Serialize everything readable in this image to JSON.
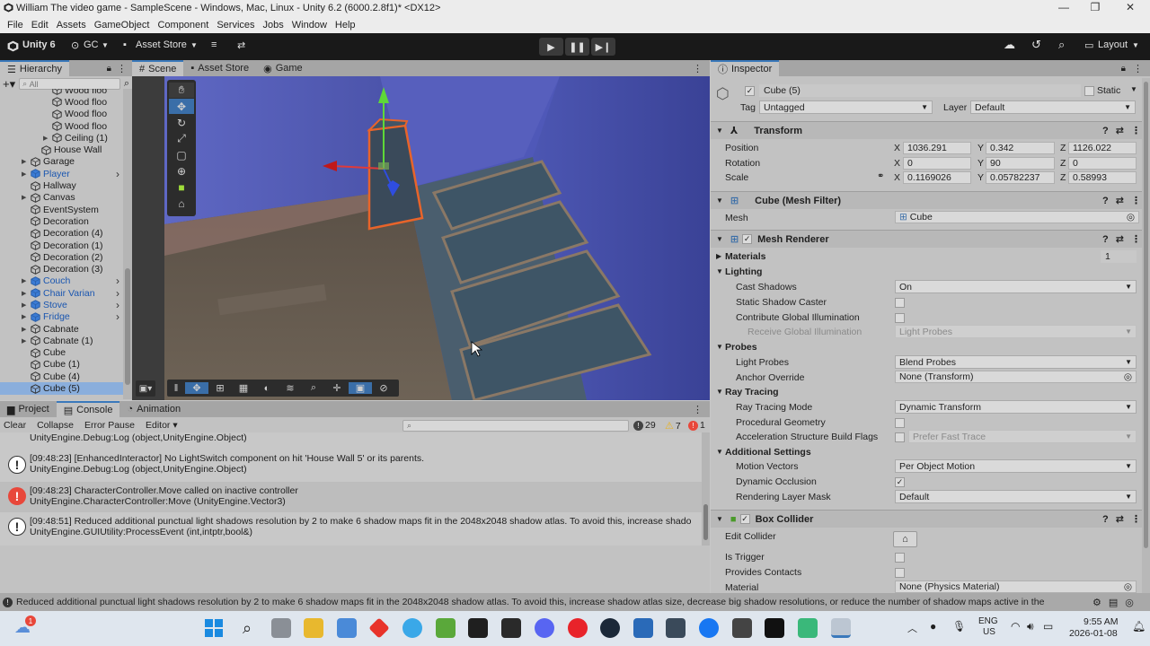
{
  "window": {
    "title": "William The video game - SampleScene - Windows, Mac, Linux - Unity 6.2 (6000.2.8f1)* <DX12>",
    "minimize": "—",
    "maximize": "❐",
    "close": "✕"
  },
  "menu": [
    "File",
    "Edit",
    "Assets",
    "GameObject",
    "Component",
    "Services",
    "Jobs",
    "Window",
    "Help"
  ],
  "toolbar": {
    "account": "Unity 6",
    "gc": "GC",
    "asset_store": "Asset Store",
    "layout": "Layout"
  },
  "hierarchy": {
    "tab": "Hierarchy",
    "search_placeholder": "All",
    "items": [
      {
        "label": "Wood floo",
        "indent": 5,
        "style": "normal",
        "arrow": false
      },
      {
        "label": "Wood floo",
        "indent": 5,
        "style": "normal",
        "arrow": false
      },
      {
        "label": "Wood floo",
        "indent": 5,
        "style": "normal",
        "arrow": false
      },
      {
        "label": "Wood floo",
        "indent": 5,
        "style": "normal",
        "arrow": false
      },
      {
        "label": "Ceiling (1)",
        "indent": 5,
        "style": "normal",
        "arrow": true
      },
      {
        "label": "House Wall",
        "indent": 4,
        "style": "normal",
        "arrow": false
      },
      {
        "label": "Garage",
        "indent": 3,
        "style": "normal",
        "arrow": true
      },
      {
        "label": "Player",
        "indent": 3,
        "style": "blue",
        "arrow": true
      },
      {
        "label": "Hallway",
        "indent": 3,
        "style": "normal",
        "arrow": false
      },
      {
        "label": "Canvas",
        "indent": 3,
        "style": "normal",
        "arrow": true
      },
      {
        "label": "EventSystem",
        "indent": 3,
        "style": "normal",
        "arrow": false
      },
      {
        "label": "Decoration",
        "indent": 3,
        "style": "normal",
        "arrow": false
      },
      {
        "label": "Decoration (4)",
        "indent": 3,
        "style": "normal",
        "arrow": false
      },
      {
        "label": "Decoration (1)",
        "indent": 3,
        "style": "normal",
        "arrow": false
      },
      {
        "label": "Decoration (2)",
        "indent": 3,
        "style": "normal",
        "arrow": false
      },
      {
        "label": "Decoration (3)",
        "indent": 3,
        "style": "normal",
        "arrow": false
      },
      {
        "label": "Couch",
        "indent": 3,
        "style": "blue",
        "arrow": true
      },
      {
        "label": "Chair Varian",
        "indent": 3,
        "style": "blue",
        "arrow": true
      },
      {
        "label": "Stove",
        "indent": 3,
        "style": "blue",
        "arrow": true
      },
      {
        "label": "Fridge",
        "indent": 3,
        "style": "blue",
        "arrow": true
      },
      {
        "label": "Cabnate",
        "indent": 3,
        "style": "normal",
        "arrow": true
      },
      {
        "label": "Cabnate (1)",
        "indent": 3,
        "style": "normal",
        "arrow": true
      },
      {
        "label": "Cube",
        "indent": 3,
        "style": "normal",
        "arrow": false
      },
      {
        "label": "Cube (1)",
        "indent": 3,
        "style": "normal",
        "arrow": false
      },
      {
        "label": "Cube (4)",
        "indent": 3,
        "style": "normal",
        "arrow": false
      },
      {
        "label": "Cube (5)",
        "indent": 3,
        "style": "selected",
        "arrow": false
      }
    ]
  },
  "scene_tabs": [
    "Scene",
    "Asset Store",
    "Game"
  ],
  "bottom_tabs": [
    "Project",
    "Console",
    "Animation"
  ],
  "console": {
    "clear": "Clear",
    "collapse": "Collapse",
    "error_pause": "Error Pause",
    "editor": "Editor",
    "count_info": "29",
    "count_warn": "7",
    "count_err": "1",
    "entries": [
      {
        "type": "info",
        "line1": "",
        "line2": "UnityEngine.Debug:Log (object,UnityEngine.Object)"
      },
      {
        "type": "info",
        "line1": "[09:48:23] [EnhancedInteractor] No LightSwitch component on hit 'House Wall 5' or its parents.",
        "line2": "UnityEngine.Debug:Log (object,UnityEngine.Object)"
      },
      {
        "type": "error",
        "line1": "[09:48:23] CharacterController.Move called on inactive controller",
        "line2": "UnityEngine.CharacterController:Move (UnityEngine.Vector3)"
      },
      {
        "type": "info",
        "line1": "[09:48:51] Reduced additional punctual light shadows resolution by 2 to make 6 shadow maps fit in the 2048x2048 shadow atlas. To avoid this, increase shado",
        "line2": "UnityEngine.GUIUtility:ProcessEvent (int,intptr,bool&)"
      }
    ]
  },
  "inspector": {
    "tab": "Inspector",
    "object_name": "Cube (5)",
    "static": "Static",
    "tag_label": "Tag",
    "tag_value": "Untagged",
    "layer_label": "Layer",
    "layer_value": "Default",
    "transform": {
      "title": "Transform",
      "position_label": "Position",
      "rotation_label": "Rotation",
      "scale_label": "Scale",
      "position": [
        "1036.291",
        "0.342",
        "1126.022"
      ],
      "rotation": [
        "0",
        "90",
        "0"
      ],
      "scale": [
        "0.1169026",
        "0.05782237",
        "0.58993"
      ]
    },
    "mesh_filter": {
      "title": "Cube (Mesh Filter)",
      "mesh_label": "Mesh",
      "mesh_value": "Cube"
    },
    "mesh_renderer": {
      "title": "Mesh Renderer",
      "materials": "Materials",
      "materials_count": "1",
      "lighting": "Lighting",
      "cast_shadows": "Cast Shadows",
      "cast_shadows_value": "On",
      "static_shadow_caster": "Static Shadow Caster",
      "contribute_gi": "Contribute Global Illumination",
      "receive_gi": "Receive Global Illumination",
      "receive_gi_value": "Light Probes",
      "probes": "Probes",
      "light_probes": "Light Probes",
      "light_probes_value": "Blend Probes",
      "anchor_override": "Anchor Override",
      "anchor_override_value": "None (Transform)",
      "ray_tracing": "Ray Tracing",
      "ray_tracing_mode": "Ray Tracing Mode",
      "ray_tracing_mode_value": "Dynamic Transform",
      "procedural_geometry": "Procedural Geometry",
      "accel_build_flags": "Acceleration Structure Build Flags",
      "accel_build_flags_value": "Prefer Fast Trace",
      "additional_settings": "Additional Settings",
      "motion_vectors": "Motion Vectors",
      "motion_vectors_value": "Per Object Motion",
      "dynamic_occlusion": "Dynamic Occlusion",
      "rendering_layer_mask": "Rendering Layer Mask",
      "rendering_layer_mask_value": "Default"
    },
    "box_collider": {
      "title": "Box Collider",
      "edit_collider": "Edit Collider",
      "is_trigger": "Is Trigger",
      "provides_contacts": "Provides Contacts",
      "material": "Material",
      "material_value": "None (Physics Material)"
    }
  },
  "statusbar": {
    "message": "Reduced additional punctual light shadows resolution by 2 to make 6 shadow maps fit in the 2048x2048 shadow atlas. To avoid this, increase shadow atlas size, decrease big shadow resolutions, or reduce the number of shadow maps active in the"
  },
  "taskbar": {
    "lang1": "ENG",
    "lang2": "US",
    "time": "9:55 AM",
    "date": "2026-01-08",
    "badge": "1"
  },
  "colors": {
    "accent": "#3a79bb",
    "error": "#e8473a",
    "warning": "#e9b320",
    "selection": "#8aaedc",
    "toolbar": "#191919"
  }
}
